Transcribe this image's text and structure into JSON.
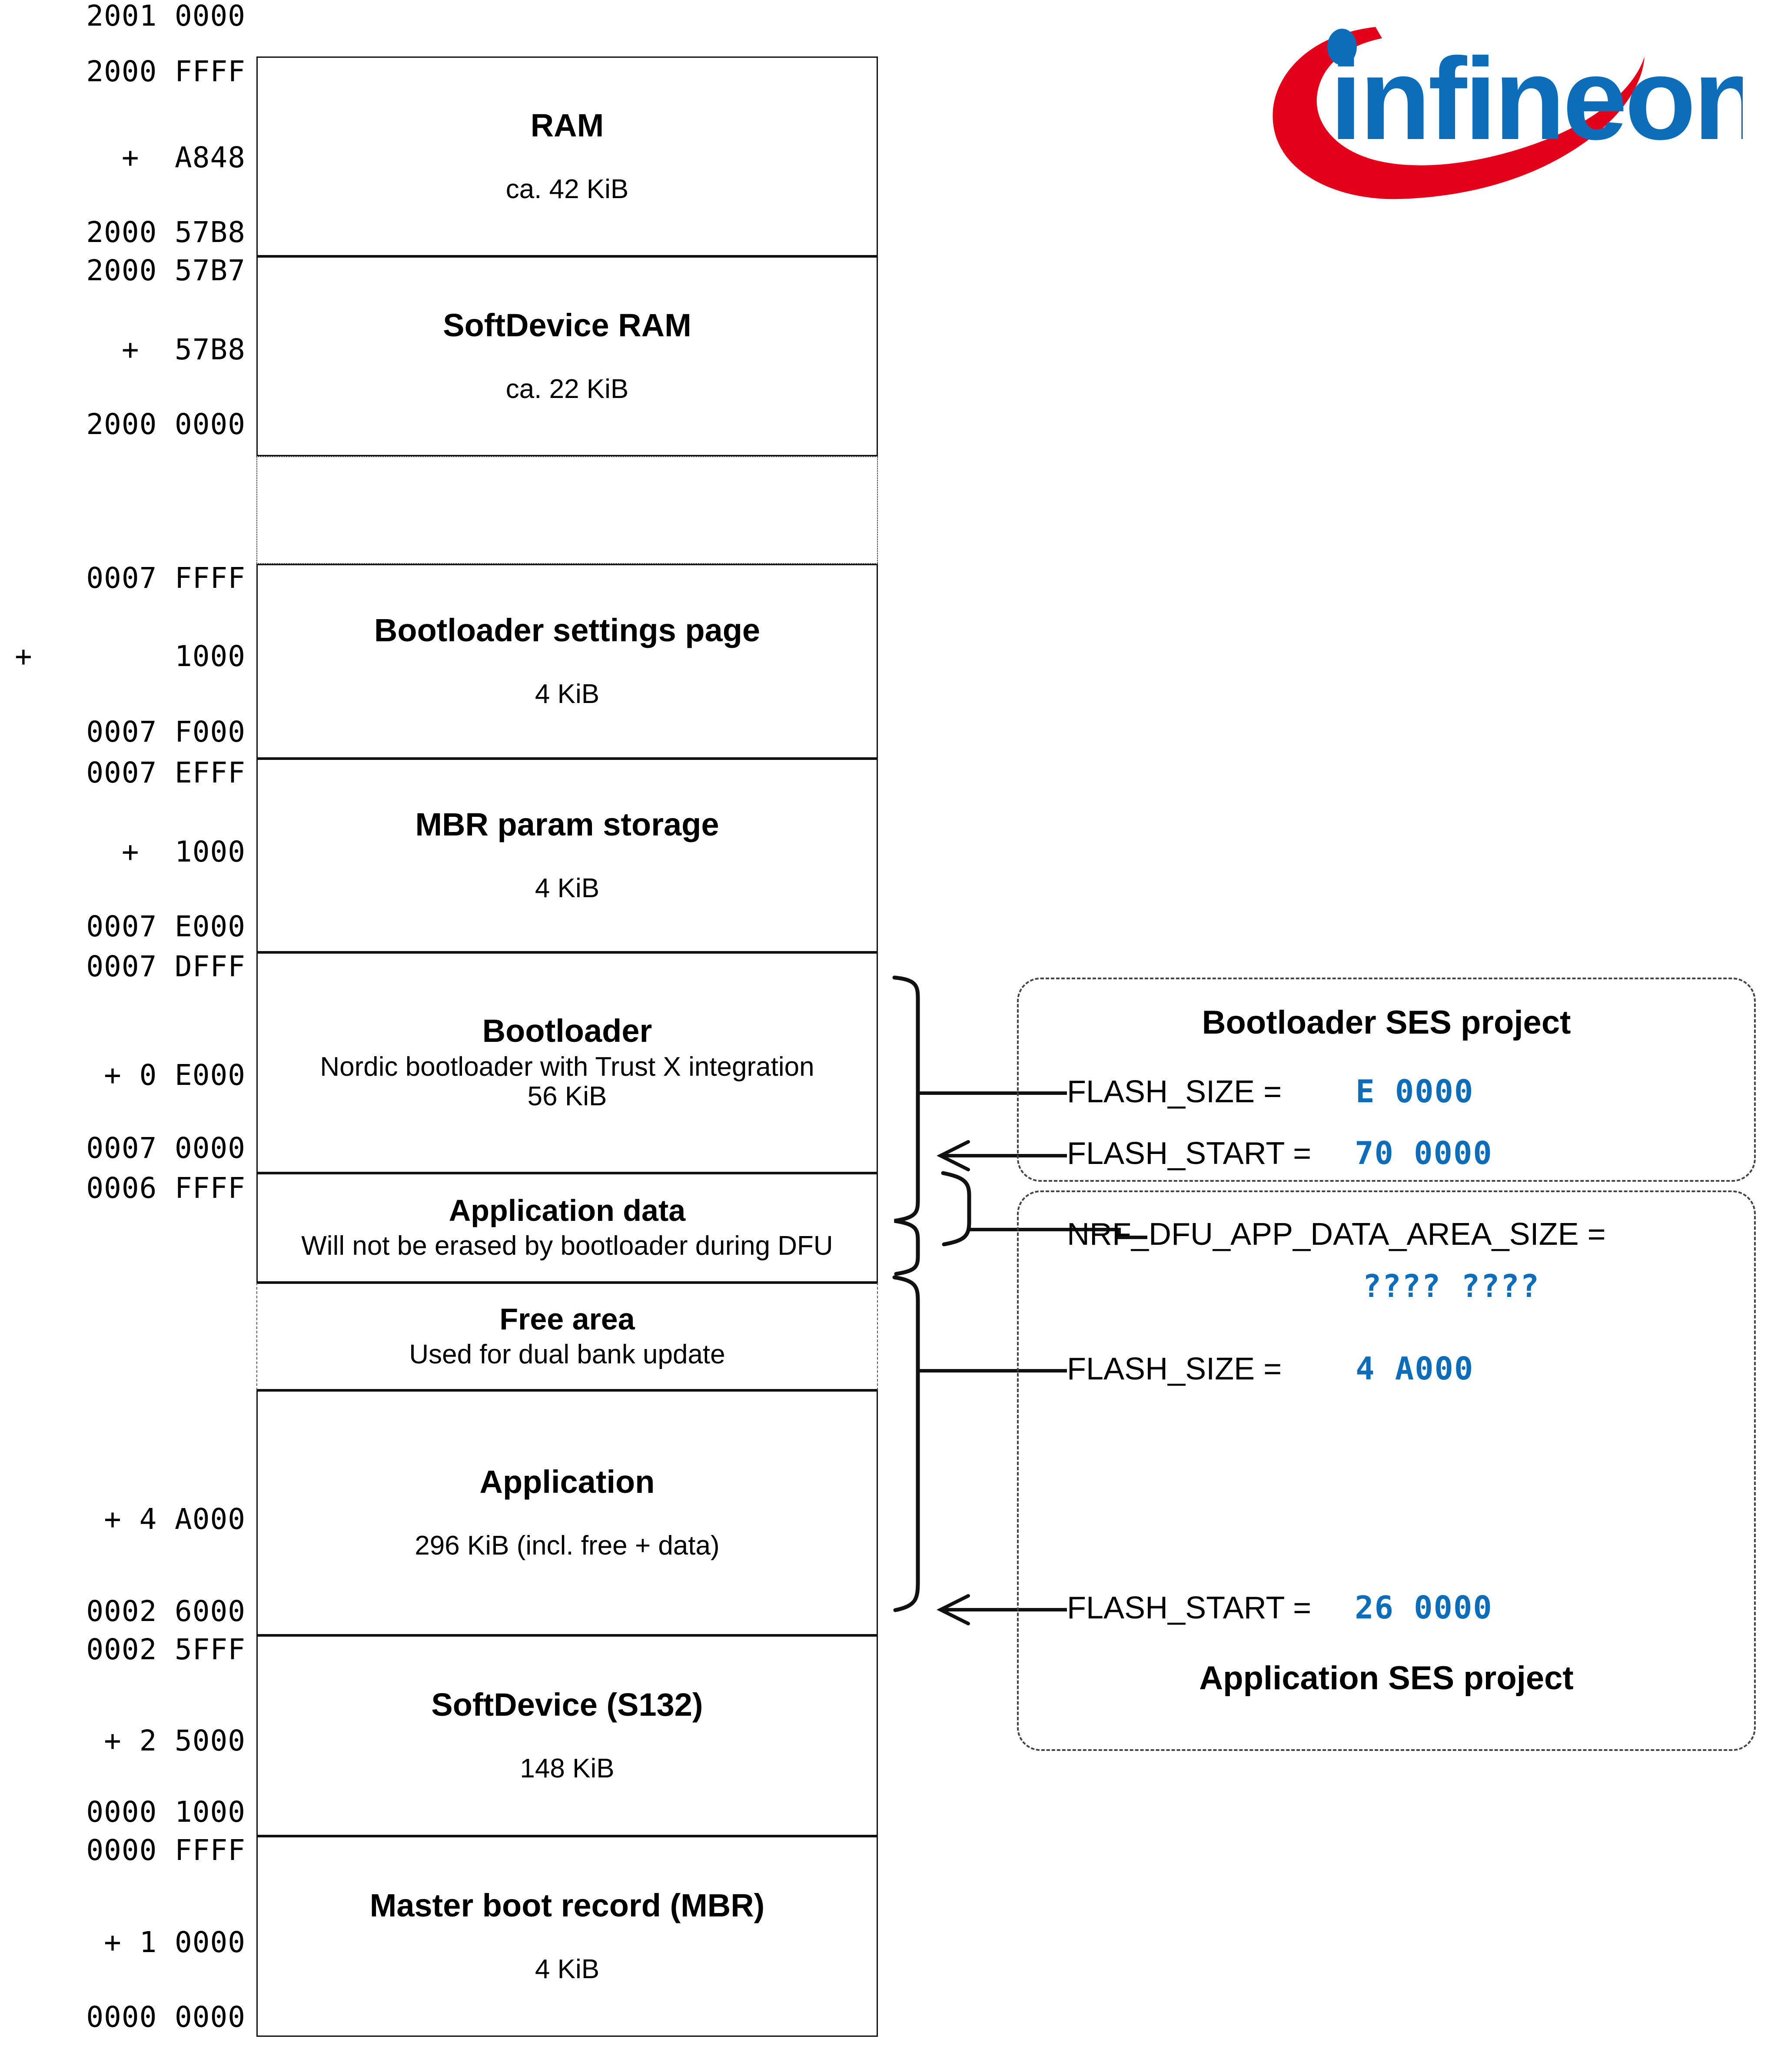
{
  "brand": {
    "name": "infineon",
    "red": "#e2001a",
    "blue": "#0d6db9"
  },
  "colors": {
    "hex_value_blue": "#0d6db9",
    "outline": "#111111",
    "dashed": "#444444"
  },
  "address_labels": [
    {
      "id": "ram-top",
      "text": "2001 0000"
    },
    {
      "id": "ram-end",
      "text": "2000 FFFF"
    },
    {
      "id": "ram-size-offset",
      "text": "+  A848"
    },
    {
      "id": "ram-base",
      "text": "2000 57B8"
    },
    {
      "id": "sdram-end",
      "text": "2000 57B7"
    },
    {
      "id": "sdram-size-offset",
      "text": "+  57B8"
    },
    {
      "id": "sdram-base",
      "text": "2000 0000"
    },
    {
      "id": "blsettings-end",
      "text": "0007 FFFF"
    },
    {
      "id": "blsettings-offset",
      "text": "1000"
    },
    {
      "id": "blsettings-base",
      "text": "0007 F000"
    },
    {
      "id": "mbrparam-end",
      "text": "0007 EFFF"
    },
    {
      "id": "mbrparam-offset",
      "text": "+  1000"
    },
    {
      "id": "mbrparam-base",
      "text": "0007 E000"
    },
    {
      "id": "bootloader-end",
      "text": "0007 DFFF"
    },
    {
      "id": "bootloader-offset",
      "text": "+ 0 E000"
    },
    {
      "id": "bootloader-base",
      "text": "0007 0000"
    },
    {
      "id": "appdata-end",
      "text": "0006 FFFF"
    },
    {
      "id": "app-offset",
      "text": "+ 4 A000"
    },
    {
      "id": "app-base",
      "text": "0002 6000"
    },
    {
      "id": "softdevice-end",
      "text": "0002 5FFF"
    },
    {
      "id": "softdevice-offset",
      "text": "+ 2 5000"
    },
    {
      "id": "softdevice-base",
      "text": "0000 1000"
    },
    {
      "id": "mbr-end",
      "text": "0000 FFFF"
    },
    {
      "id": "mbr-offset",
      "text": "+ 1 0000"
    },
    {
      "id": "mbr-base",
      "text": "0000 0000"
    }
  ],
  "far_left_plus": "+",
  "memory_blocks": [
    {
      "id": "ram",
      "title": "RAM",
      "sub1": "",
      "sub2": "ca. 42 KiB",
      "style": "solid"
    },
    {
      "id": "softdevice-ram",
      "title": "SoftDevice RAM",
      "sub1": "",
      "sub2": "ca. 22 KiB",
      "style": "solid"
    },
    {
      "id": "address-gap",
      "title": "",
      "sub1": "",
      "sub2": "",
      "style": "dotted"
    },
    {
      "id": "bootloader-settings",
      "title": "Bootloader settings page",
      "sub1": "",
      "sub2": "4 KiB",
      "style": "solid"
    },
    {
      "id": "mbr-param-storage",
      "title": "MBR param storage",
      "sub1": "",
      "sub2": "4 KiB",
      "style": "solid"
    },
    {
      "id": "bootloader",
      "title": "Bootloader",
      "sub1": "Nordic bootloader with Trust X integration",
      "sub2": "56  KiB",
      "style": "solid"
    },
    {
      "id": "application-data",
      "title": "Application data",
      "sub1": "Will not be erased by bootloader during DFU",
      "sub2": "",
      "style": "solid"
    },
    {
      "id": "free-area",
      "title": "Free area",
      "sub1": "Used for dual bank update",
      "sub2": "",
      "style": "dash-sides"
    },
    {
      "id": "application",
      "title": "Application",
      "sub1": "",
      "sub2": "296 KiB (incl. free + data)",
      "style": "solid"
    },
    {
      "id": "softdevice",
      "title": "SoftDevice (S132)",
      "sub1": "",
      "sub2": "148 KiB",
      "style": "solid"
    },
    {
      "id": "master-boot-record",
      "title": "Master boot record (MBR)",
      "sub1": "",
      "sub2": "4 KiB",
      "style": "solid"
    }
  ],
  "ses_projects": [
    {
      "id": "bootloader-ses-project",
      "title": "Bootloader SES project",
      "title_position": "top",
      "entries": [
        {
          "key": "FLASH_SIZE =",
          "value": "E 0000"
        },
        {
          "key": "FLASH_START =",
          "value": "70 0000"
        }
      ]
    },
    {
      "id": "application-ses-project",
      "title": "Application SES project",
      "title_position": "bottom",
      "entries": [
        {
          "key": "NRF_DFU_APP_DATA_AREA_SIZE =",
          "value": "???? ????"
        },
        {
          "key": "FLASH_SIZE =",
          "value": "4 A000"
        },
        {
          "key": "FLASH_START =",
          "value": "26 0000"
        }
      ]
    }
  ]
}
